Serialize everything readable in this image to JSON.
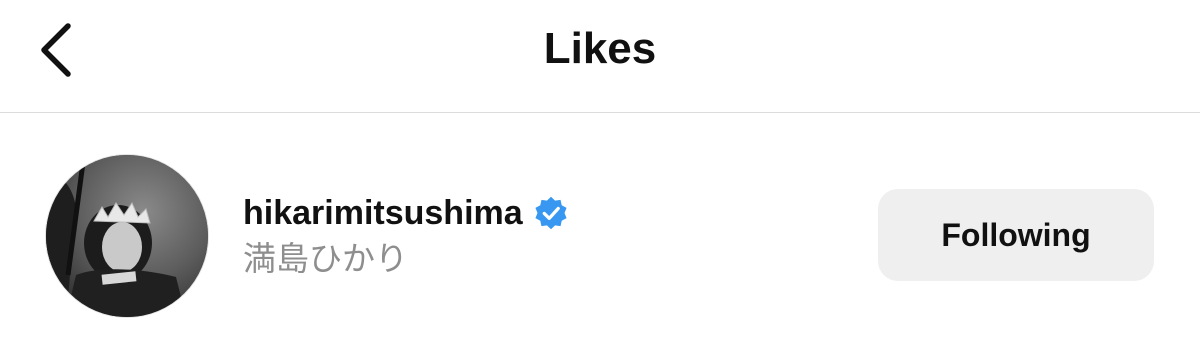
{
  "header": {
    "title": "Likes",
    "back_icon": "chevron-left-icon"
  },
  "likes": [
    {
      "username": "hikarimitsushima",
      "display_name": "満島ひかり",
      "verified": true,
      "verified_icon": "verified-badge-icon",
      "verified_color": "#3897f0",
      "follow_status": "Following"
    }
  ],
  "colors": {
    "button_bg": "#efefef",
    "secondary_text": "#8e8e8e",
    "divider": "#dcdcdc"
  }
}
